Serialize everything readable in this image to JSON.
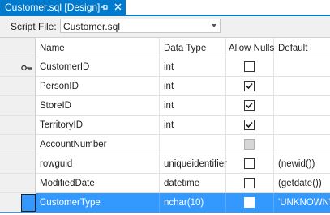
{
  "tab": {
    "title": "Customer.sql [Design]",
    "pin_icon": "pin-icon",
    "close_icon": "close-icon"
  },
  "script_file": {
    "label": "Script File:",
    "value": "Customer.sql"
  },
  "grid": {
    "headers": {
      "name": "Name",
      "data_type": "Data Type",
      "allow_nulls": "Allow Nulls",
      "default": "Default"
    },
    "rows": [
      {
        "name": "CustomerID",
        "data_type": "int",
        "allow_nulls": false,
        "nulls_disabled": false,
        "default": "",
        "primary_key": true,
        "selected": false
      },
      {
        "name": "PersonID",
        "data_type": "int",
        "allow_nulls": true,
        "nulls_disabled": false,
        "default": "",
        "primary_key": false,
        "selected": false
      },
      {
        "name": "StoreID",
        "data_type": "int",
        "allow_nulls": true,
        "nulls_disabled": false,
        "default": "",
        "primary_key": false,
        "selected": false
      },
      {
        "name": "TerritoryID",
        "data_type": "int",
        "allow_nulls": true,
        "nulls_disabled": false,
        "default": "",
        "primary_key": false,
        "selected": false
      },
      {
        "name": "AccountNumber",
        "data_type": "",
        "allow_nulls": false,
        "nulls_disabled": true,
        "default": "",
        "primary_key": false,
        "selected": false
      },
      {
        "name": "rowguid",
        "data_type": "uniqueidentifier",
        "allow_nulls": false,
        "nulls_disabled": false,
        "default": "(newid())",
        "primary_key": false,
        "selected": false
      },
      {
        "name": "ModifiedDate",
        "data_type": "datetime",
        "allow_nulls": false,
        "nulls_disabled": false,
        "default": "(getdate())",
        "primary_key": false,
        "selected": false
      },
      {
        "name": "CustomerType",
        "data_type": "nchar(10)",
        "allow_nulls": false,
        "nulls_disabled": false,
        "default": "'UNKNOWN'",
        "primary_key": false,
        "selected": true
      }
    ]
  },
  "colors": {
    "accent": "#007acc",
    "selection": "#3399ff",
    "background": "#f0f0f0",
    "grid_line": "#e3e3e3"
  },
  "icons": {
    "primary_key": "key-icon",
    "dropdown": "chevron-down-icon",
    "checked": "checkmark-icon"
  }
}
